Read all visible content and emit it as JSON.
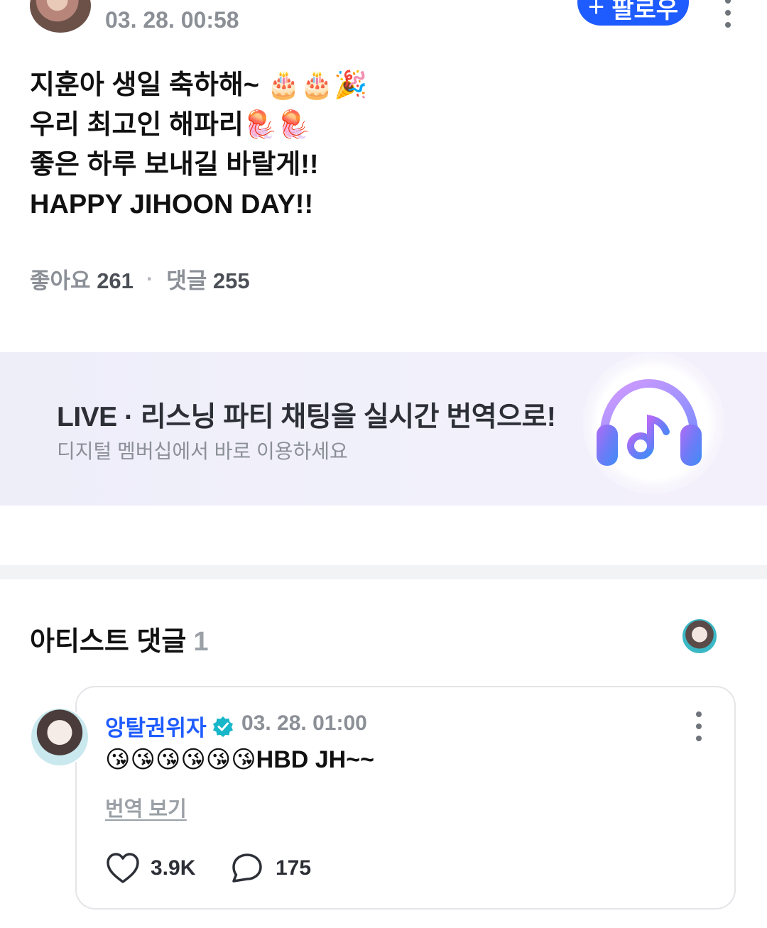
{
  "post": {
    "username": "",
    "timestamp": "03. 28. 00:58",
    "follow_label": "팔로우",
    "follow_icon": "+",
    "body_lines": [
      "지훈아 생일 축하해~ 🎂🎂🎉",
      "우리 최고인 해파리🪼🪼",
      "좋은 하루 보내길 바랄게!!",
      "HAPPY JIHOON DAY!!"
    ],
    "likes_label": "좋아요",
    "likes_count": "261",
    "separator": "·",
    "comments_label": "댓글",
    "comments_count": "255"
  },
  "banner": {
    "title": "LIVE · 리스닝 파티 채팅을 실시간 번역으로!",
    "subtitle": "디지털 멤버십에서 바로 이용하세요",
    "icon": "headphones-music-icon"
  },
  "artist_comments": {
    "title": "아티스트 댓글",
    "count": "1"
  },
  "comment": {
    "author": "앙탈권위자",
    "verified_icon": "verified-badge-icon",
    "timestamp": "03. 28. 01:00",
    "text": "😘😘😘😘😘😘HBD JH~~",
    "translate_label": "번역 보기",
    "like_count": "3.9K",
    "reply_count": "175"
  },
  "colors": {
    "accent": "#1f5cff",
    "muted_text": "#8b8f96",
    "divider": "#f2f3f5"
  }
}
